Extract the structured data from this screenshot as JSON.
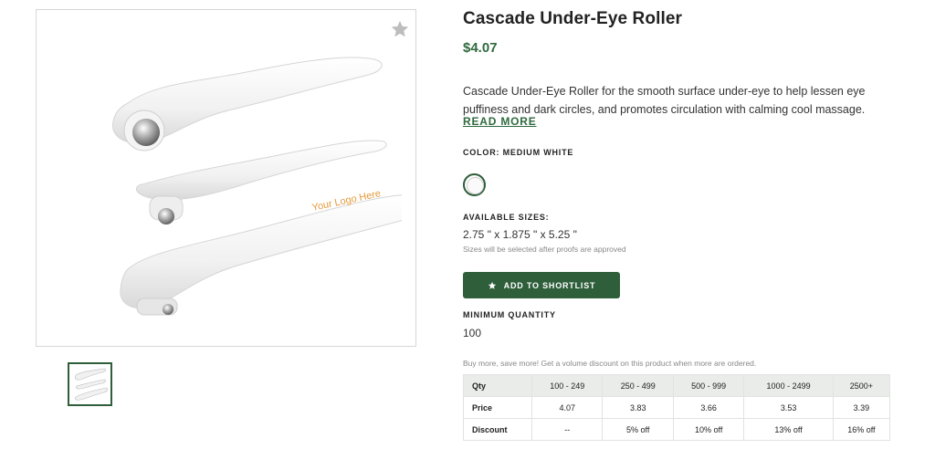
{
  "product": {
    "title": "Cascade Under-Eye Roller",
    "price": "$4.07",
    "description": "Cascade Under-Eye Roller for the smooth surface under-eye to help lessen eye puffiness and dark circles, and promotes circulation with calming cool massage. Thi…",
    "read_more": "READ MORE",
    "color_label": "COLOR: MEDIUM WHITE",
    "sizes_label": "AVAILABLE SIZES:",
    "size_value": "2.75 \" x 1.875 \" x 5.25 \"",
    "size_note": "Sizes will be selected after proofs are approved",
    "shortlist_button": "ADD TO SHORTLIST",
    "min_qty_label": "MINIMUM QUANTITY",
    "min_qty_value": "100",
    "volume_note": "Buy more, save more! Get a volume discount on this product when more are ordered.",
    "imprint_text": "Your Logo Here"
  },
  "colors": {
    "accent": "#2e5e3a",
    "price": "#2e6a3e",
    "table_header_bg": "#e9ece9"
  },
  "icons": {
    "favorite": "star-icon",
    "shortlist": "star-icon"
  },
  "pricing_table": {
    "headers": [
      "Qty",
      "100 - 249",
      "250 - 499",
      "500 - 999",
      "1000 - 2499",
      "2500+"
    ],
    "price": [
      "Price",
      "4.07",
      "3.83",
      "3.66",
      "3.53",
      "3.39"
    ],
    "discount": [
      "Discount",
      "--",
      "5% off",
      "10% off",
      "13% off",
      "16% off"
    ]
  }
}
